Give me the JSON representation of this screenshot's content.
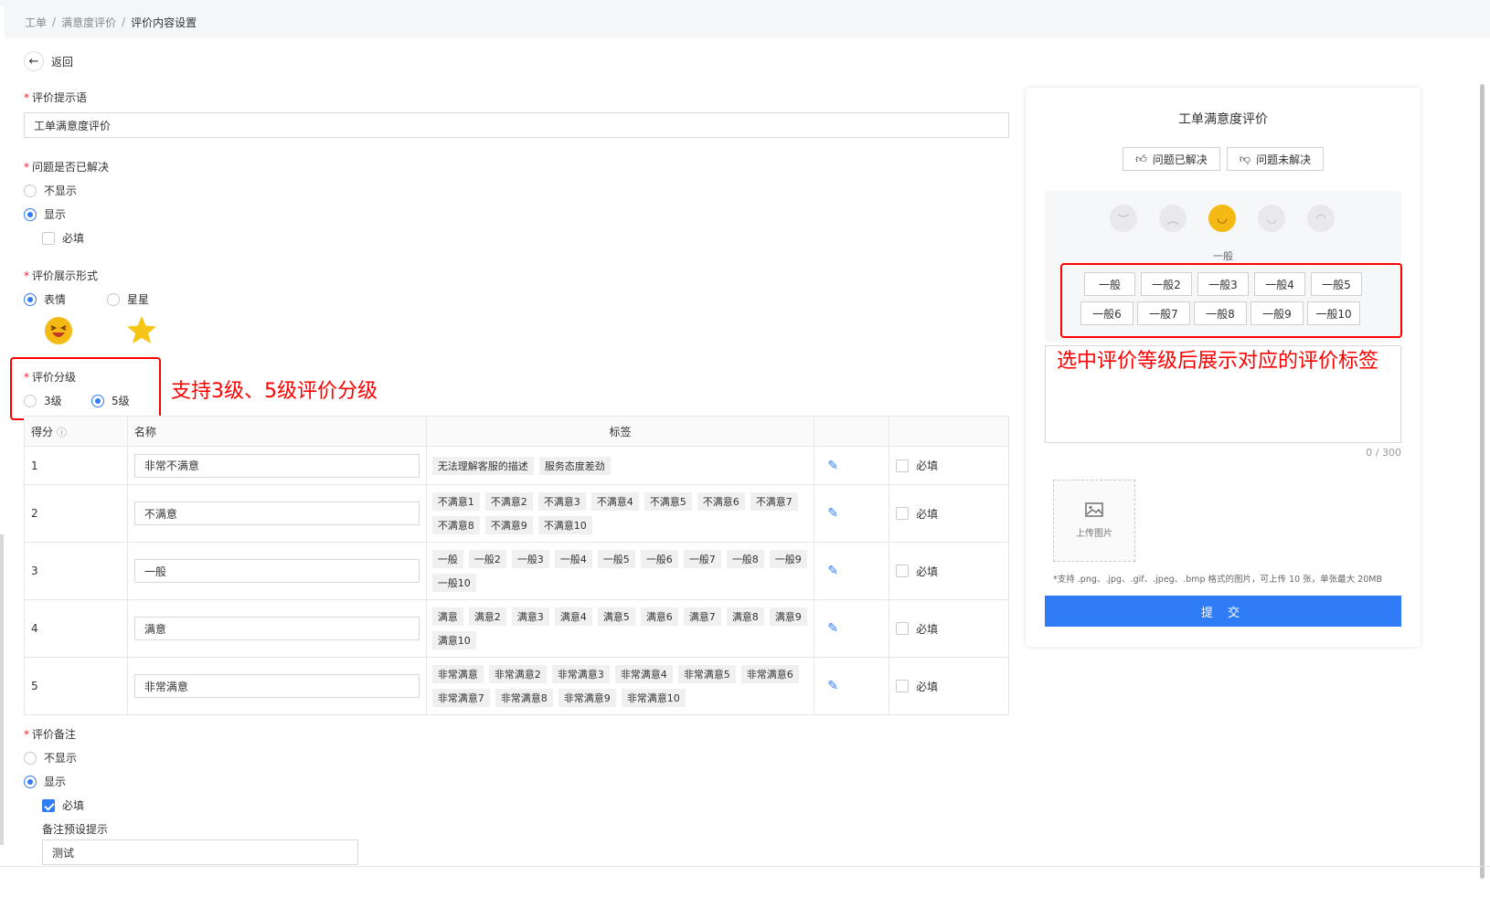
{
  "breadcrumb": [
    "工单",
    "满意度评价",
    "评价内容设置"
  ],
  "back_label": "返回",
  "prompt": {
    "label": "评价提示语",
    "value": "工单满意度评价"
  },
  "resolved": {
    "label": "问题是否已解决",
    "options": [
      "不显示",
      "显示"
    ],
    "selected": "显示",
    "required_label": "必填",
    "required_checked": false
  },
  "display_form": {
    "label": "评价展示形式",
    "options": [
      "表情",
      "星星"
    ],
    "selected": "表情"
  },
  "grading": {
    "label": "评价分级",
    "options": [
      "3级",
      "5级"
    ],
    "selected": "5级",
    "annotation": "支持3级、5级评价分级"
  },
  "table": {
    "headers": {
      "score": "得分",
      "name": "名称",
      "tags": "标签"
    },
    "required_label": "必填",
    "rows": [
      {
        "score": "1",
        "name": "非常不满意",
        "tags": [
          "无法理解客服的描述",
          "服务态度差劲"
        ]
      },
      {
        "score": "2",
        "name": "不满意",
        "tags": [
          "不满意1",
          "不满意2",
          "不满意3",
          "不满意4",
          "不满意5",
          "不满意6",
          "不满意7",
          "不满意8",
          "不满意9",
          "不满意10"
        ]
      },
      {
        "score": "3",
        "name": "一般",
        "tags": [
          "一般",
          "一般2",
          "一般3",
          "一般4",
          "一般5",
          "一般6",
          "一般7",
          "一般8",
          "一般9",
          "一般10"
        ]
      },
      {
        "score": "4",
        "name": "满意",
        "tags": [
          "满意",
          "满意2",
          "满意3",
          "满意4",
          "满意5",
          "满意6",
          "满意7",
          "满意8",
          "满意9",
          "满意10"
        ]
      },
      {
        "score": "5",
        "name": "非常满意",
        "tags": [
          "非常满意",
          "非常满意2",
          "非常满意3",
          "非常满意4",
          "非常满意5",
          "非常满意6",
          "非常满意7",
          "非常满意8",
          "非常满意9",
          "非常满意10"
        ]
      }
    ]
  },
  "remark": {
    "label": "评价备注",
    "options": [
      "不显示",
      "显示"
    ],
    "selected": "显示",
    "required_label": "必填",
    "required_checked": true,
    "preset_label": "备注预设提示",
    "preset_value": "测试"
  },
  "preview": {
    "title": "工单满意度评价",
    "resolved_btn": "问题已解决",
    "unresolved_btn": "问题未解决",
    "selected_face_label": "一般",
    "tags": [
      "一般",
      "一般2",
      "一般3",
      "一般4",
      "一般5",
      "一般6",
      "一般7",
      "一般8",
      "一般9",
      "一般10"
    ],
    "annotation": "选中评价等级后展示对应的评价标签",
    "char_count": "0 / 300",
    "upload_label": "上传图片",
    "upload_hint": "*支持 .png、.jpg、.gif、.jpeg、.bmp 格式的图片，可上传 10 张，单张最大 20MB",
    "submit_label": "提 交"
  },
  "colors": {
    "accent": "#2f7cf6",
    "annotation": "#ff0000",
    "emoji": "#f5b914"
  },
  "icons": [
    "back-arrow-icon",
    "info-icon",
    "edit-icon",
    "thumb-up-icon",
    "thumb-down-icon",
    "image-icon",
    "star-icon",
    "emoji-icon"
  ]
}
